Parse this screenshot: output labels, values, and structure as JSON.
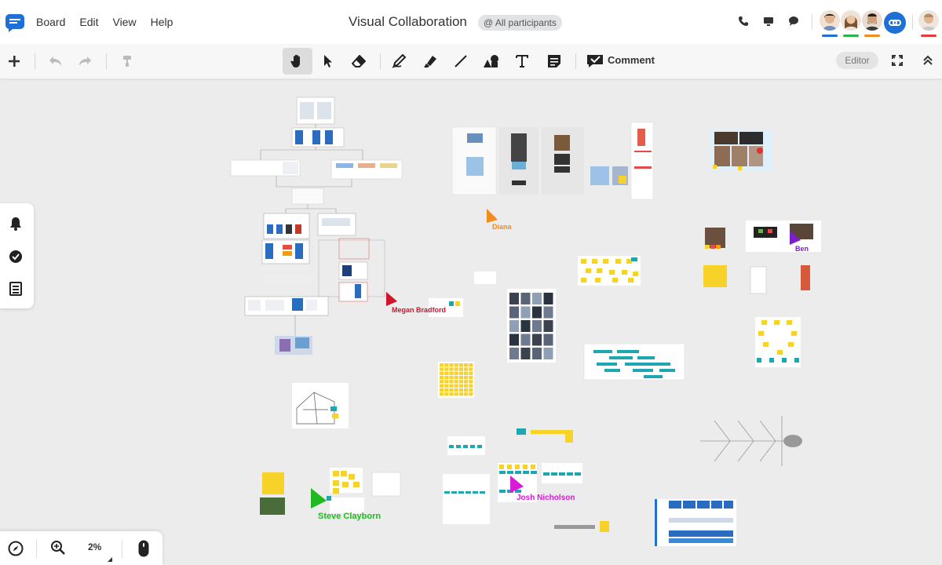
{
  "menu": {
    "items": [
      "Board",
      "Edit",
      "View",
      "Help"
    ]
  },
  "board": {
    "title": "Visual Collaboration",
    "participants_label": "@ All participants"
  },
  "toolbar": {
    "comment_label": "Comment",
    "editor_label": "Editor"
  },
  "zoom": {
    "level": "2%"
  },
  "avatars": [
    {
      "underline": "#1e70d6"
    },
    {
      "underline": "#2bb34a"
    },
    {
      "underline": "#f08c1c"
    },
    {
      "underline": "#e23b3b"
    }
  ],
  "cursors": [
    {
      "name": "Diana",
      "color": "#f08c1c"
    },
    {
      "name": "Megan Bradford",
      "color": "#d0142c"
    },
    {
      "name": "Ben",
      "color": "#7b20c8"
    },
    {
      "name": "Josh Nicholson",
      "color": "#d81bd6"
    },
    {
      "name": "Steve Clayborn",
      "color": "#22b822"
    }
  ],
  "colors": {
    "accent": "#1e70d6",
    "sticky": "#f7d32a",
    "teal": "#1fa6b3"
  }
}
